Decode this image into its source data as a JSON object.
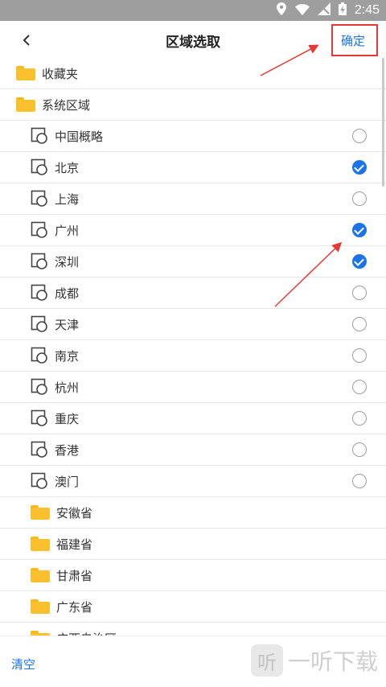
{
  "status_bar": {
    "time": "2:45",
    "icons": [
      "location-icon",
      "wifi-icon",
      "no-signal-icon",
      "battery-charging-icon"
    ]
  },
  "header": {
    "title": "区域选取",
    "confirm_label": "确定"
  },
  "list": {
    "items": [
      {
        "type": "folder",
        "level": 0,
        "label": "收藏夹"
      },
      {
        "type": "folder",
        "level": 0,
        "label": "系统区域"
      },
      {
        "type": "region",
        "level": 1,
        "label": "中国概略",
        "checked": false
      },
      {
        "type": "region",
        "level": 1,
        "label": "北京",
        "checked": true
      },
      {
        "type": "region",
        "level": 1,
        "label": "上海",
        "checked": false
      },
      {
        "type": "region",
        "level": 1,
        "label": "广州",
        "checked": true
      },
      {
        "type": "region",
        "level": 1,
        "label": "深圳",
        "checked": true
      },
      {
        "type": "region",
        "level": 1,
        "label": "成都",
        "checked": false
      },
      {
        "type": "region",
        "level": 1,
        "label": "天津",
        "checked": false
      },
      {
        "type": "region",
        "level": 1,
        "label": "南京",
        "checked": false
      },
      {
        "type": "region",
        "level": 1,
        "label": "杭州",
        "checked": false
      },
      {
        "type": "region",
        "level": 1,
        "label": "重庆",
        "checked": false
      },
      {
        "type": "region",
        "level": 1,
        "label": "香港",
        "checked": false
      },
      {
        "type": "region",
        "level": 1,
        "label": "澳门",
        "checked": false
      },
      {
        "type": "folder",
        "level": 1,
        "label": "安徽省"
      },
      {
        "type": "folder",
        "level": 1,
        "label": "福建省"
      },
      {
        "type": "folder",
        "level": 1,
        "label": "甘肃省"
      },
      {
        "type": "folder",
        "level": 1,
        "label": "广东省"
      },
      {
        "type": "folder",
        "level": 1,
        "label": "广西自治区"
      }
    ]
  },
  "footer": {
    "clear_label": "清空",
    "watermark_text": "一听下载",
    "watermark_logo": "听"
  },
  "colors": {
    "accent": "#1a73e8",
    "folder": "#fbc02d",
    "annotation": "#e53935"
  }
}
